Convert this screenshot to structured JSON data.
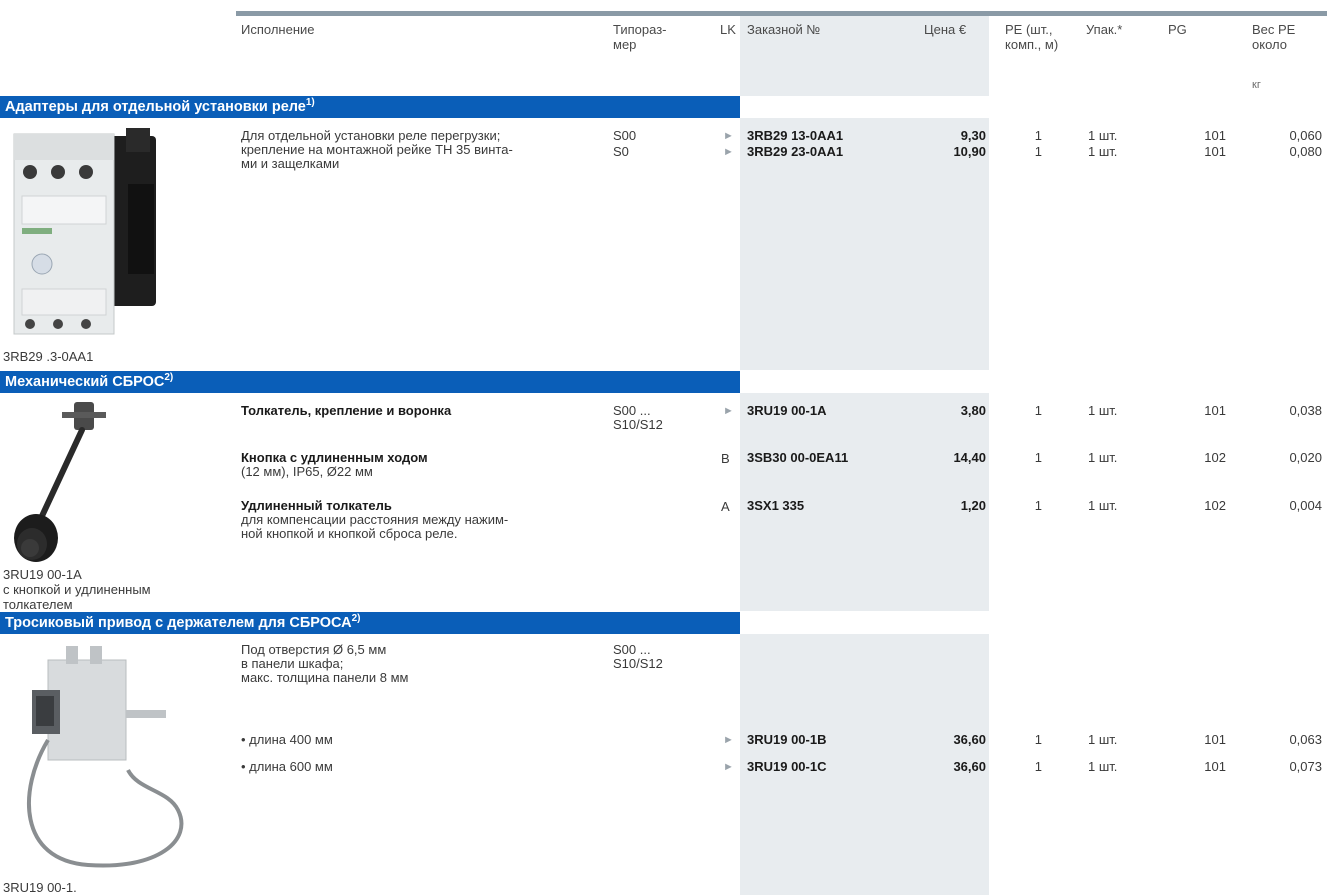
{
  "header": {
    "col_execution": "Исполнение",
    "col_size_1": "Типораз-",
    "col_size_2": "мер",
    "col_lk": "LK",
    "col_order": "Заказной №",
    "col_price": "Цена €",
    "col_pe_1": "PE (шт.,",
    "col_pe_2": "комп., м)",
    "col_pack": "Упак.*",
    "col_pg": "PG",
    "col_weight_1": "Вес PE",
    "col_weight_2": "около",
    "col_weight_unit": "кг"
  },
  "sections": [
    {
      "title": "Адаптеры для отдельной установки реле",
      "footnote": "1)",
      "image_caption": "3RB29 .3-0AA1",
      "description_lines": [
        "Для отдельной установки реле перегрузки;",
        "крепление на монтажной рейке TH 35 винта-",
        "ми и защелками"
      ],
      "rows": [
        {
          "size": "S00",
          "lk": "►",
          "order": "3RB29 13-0AA1",
          "price": "9,30",
          "pe": "1",
          "pack": "1 шт.",
          "pg": "101",
          "weight": "0,060"
        },
        {
          "size": "S0",
          "lk": "►",
          "order": "3RB29 23-0AA1",
          "price": "10,90",
          "pe": "1",
          "pack": "1 шт.",
          "pg": "101",
          "weight": "0,080"
        }
      ]
    },
    {
      "title": "Механический СБРОС",
      "footnote": "2)",
      "image_caption_lines": [
        "3RU19 00-1A",
        "с кнопкой и удлиненным",
        "толкателем"
      ],
      "rows": [
        {
          "title": "Толкатель, крепление и воронка",
          "size_1": "S00 ...",
          "size_2": "S10/S12",
          "lk": "►",
          "order": "3RU19 00-1A",
          "price": "3,80",
          "pe": "1",
          "pack": "1 шт.",
          "pg": "101",
          "weight": "0,038"
        },
        {
          "title": "Кнопка с удлиненным ходом",
          "detail": "(12 мм), IP65, Ø22 мм",
          "lk": "B",
          "order": "3SB30 00-0EA11",
          "price": "14,40",
          "pe": "1",
          "pack": "1 шт.",
          "pg": "102",
          "weight": "0,020"
        },
        {
          "title": "Удлиненный толкатель",
          "detail_lines": [
            "для компенсации расстояния между нажим-",
            "ной кнопкой и кнопкой сброса реле."
          ],
          "lk": "A",
          "order": "3SX1 335",
          "price": "1,20",
          "pe": "1",
          "pack": "1 шт.",
          "pg": "102",
          "weight": "0,004"
        }
      ]
    },
    {
      "title": "Тросиковый привод с держателем для СБРОСА",
      "footnote": "2)",
      "image_caption": "3RU19 00-1.",
      "description_lines": [
        "Под отверстия Ø 6,5 мм",
        "в панели шкафа;",
        "макс. толщина панели 8 мм"
      ],
      "size_1": "S00 ...",
      "size_2": "S10/S12",
      "rows": [
        {
          "label": "• длина 400 мм",
          "lk": "►",
          "order": "3RU19 00-1B",
          "price": "36,60",
          "pe": "1",
          "pack": "1 шт.",
          "pg": "101",
          "weight": "0,063"
        },
        {
          "label": "• длина 600 мм",
          "lk": "►",
          "order": "3RU19 00-1C",
          "price": "36,60",
          "pe": "1",
          "pack": "1 шт.",
          "pg": "101",
          "weight": "0,073"
        }
      ]
    }
  ],
  "colors": {
    "section_bar": "#0a5eb8",
    "shade": "#e8ecef",
    "header_rule": "#8a9aa6"
  }
}
